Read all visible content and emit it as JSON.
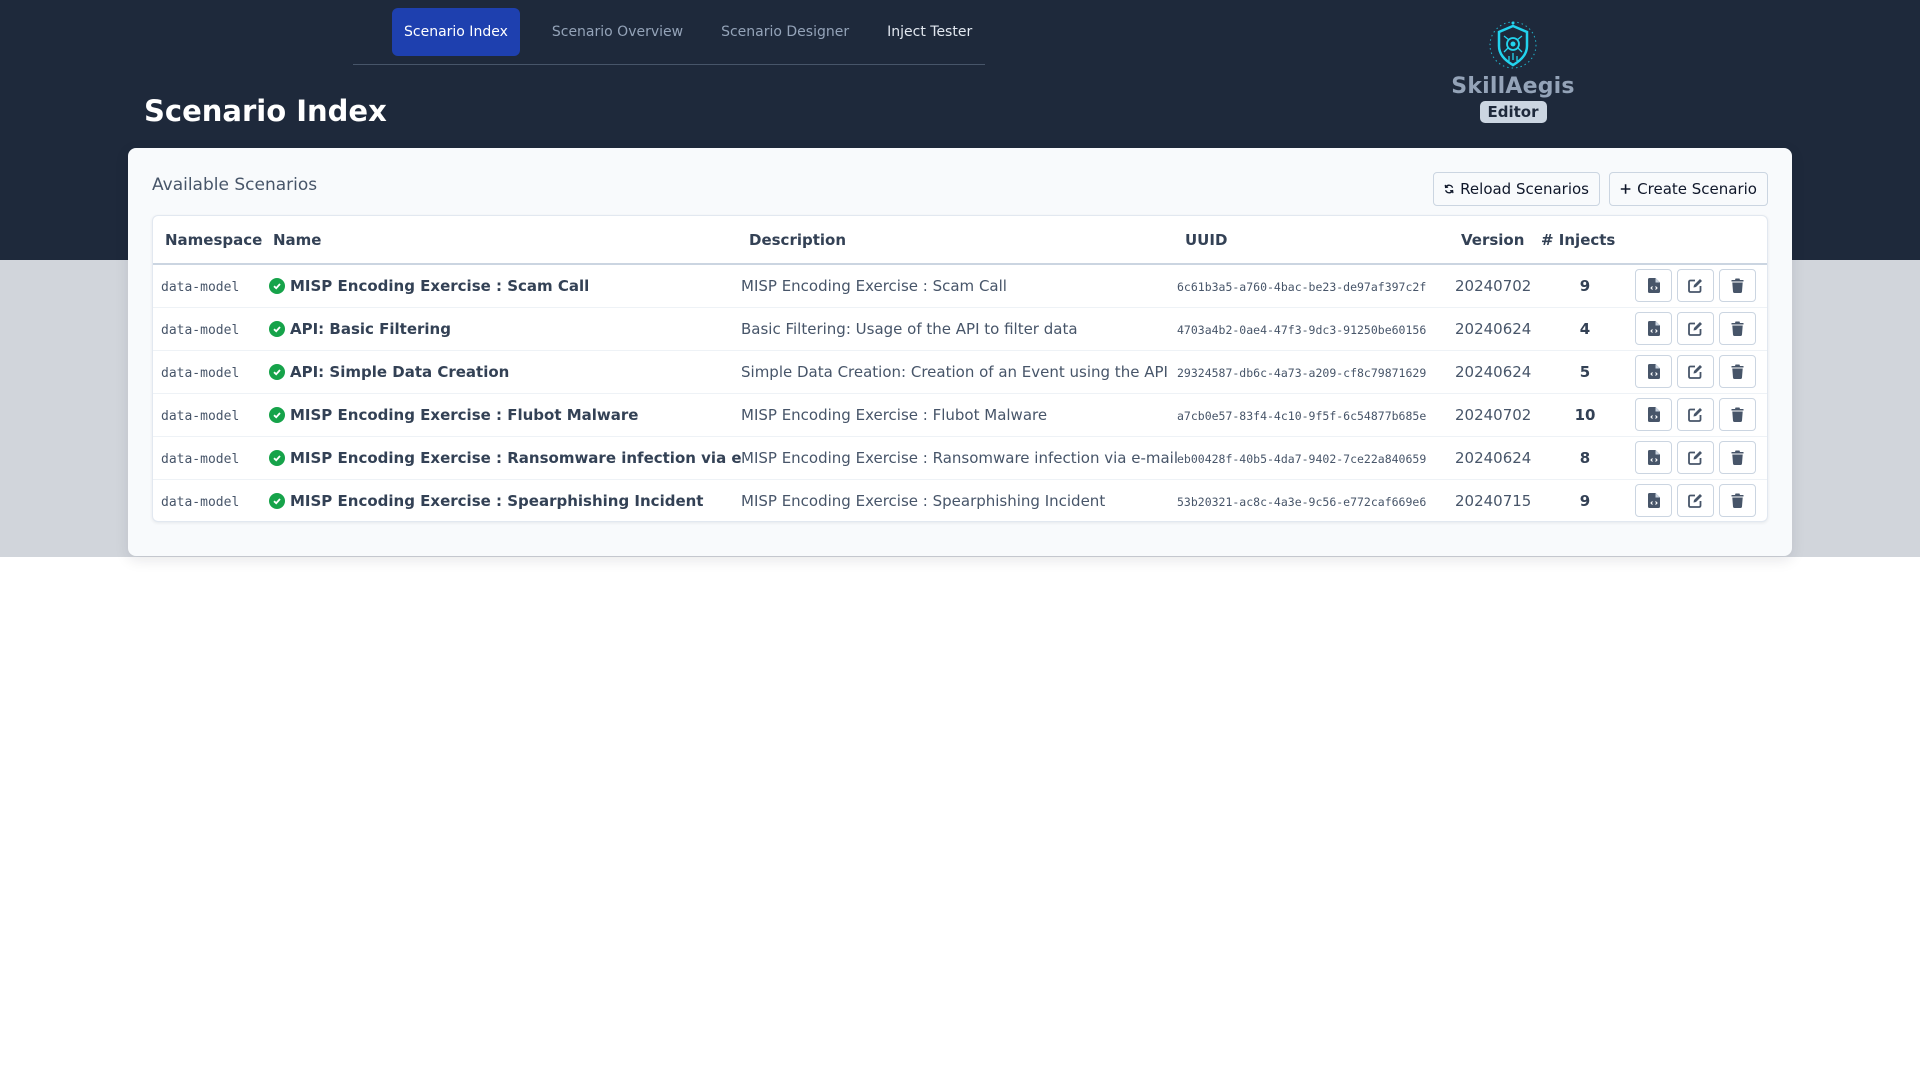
{
  "nav": {
    "tabs": [
      {
        "label": "Scenario Index",
        "active": true
      },
      {
        "label": "Scenario Overview",
        "active": false
      },
      {
        "label": "Scenario Designer",
        "active": false
      },
      {
        "label": "Inject Tester",
        "active": false
      }
    ]
  },
  "header": {
    "title": "Scenario Index"
  },
  "logo": {
    "name": "SkillAegis",
    "badge": "Editor",
    "icon": "shield-circuit-icon"
  },
  "card": {
    "title": "Available Scenarios",
    "reload_label": "Reload Scenarios",
    "create_label": "Create Scenario"
  },
  "table": {
    "columns": [
      "Namespace",
      "Name",
      "Description",
      "UUID",
      "Version",
      "# Injects",
      ""
    ],
    "rows": [
      {
        "namespace": "data-model",
        "name": "MISP Encoding Exercise : Scam Call",
        "description": "MISP Encoding Exercise : Scam Call",
        "uuid": "6c61b3a5-a760-4bac-be23-de97af397c2f",
        "version": "20240702",
        "injects": "9",
        "valid": true
      },
      {
        "namespace": "data-model",
        "name": "API: Basic Filtering",
        "description": "Basic Filtering: Usage of the API to filter data",
        "uuid": "4703a4b2-0ae4-47f3-9dc3-91250be60156",
        "version": "20240624",
        "injects": "4",
        "valid": true
      },
      {
        "namespace": "data-model",
        "name": "API: Simple Data Creation",
        "description": "Simple Data Creation: Creation of an Event using the API",
        "uuid": "29324587-db6c-4a73-a209-cf8c79871629",
        "version": "20240624",
        "injects": "5",
        "valid": true
      },
      {
        "namespace": "data-model",
        "name": "MISP Encoding Exercise : Flubot Malware",
        "description": "MISP Encoding Exercise : Flubot Malware",
        "uuid": "a7cb0e57-83f4-4c10-9f5f-6c54877b685e",
        "version": "20240702",
        "injects": "10",
        "valid": true
      },
      {
        "namespace": "data-model",
        "name": "MISP Encoding Exercise : Ransomware infection via e-mail",
        "description": "MISP Encoding Exercise : Ransomware infection via e-mail",
        "uuid": "eb00428f-40b5-4da7-9402-7ce22a840659",
        "version": "20240624",
        "injects": "8",
        "valid": true
      },
      {
        "namespace": "data-model",
        "name": "MISP Encoding Exercise : Spearphishing Incident",
        "description": "MISP Encoding Exercise : Spearphishing Incident",
        "uuid": "53b20321-ac8c-4a3e-9c56-e772caf669e6",
        "version": "20240715",
        "injects": "9",
        "valid": true
      }
    ],
    "row_actions": [
      "export-json-icon",
      "edit-icon",
      "trash-icon"
    ]
  },
  "colors": {
    "header_bg": "#1e293b",
    "active_tab": "#1e40af",
    "valid_check": "#16a34a",
    "logo_accent": "#22d3ee"
  }
}
